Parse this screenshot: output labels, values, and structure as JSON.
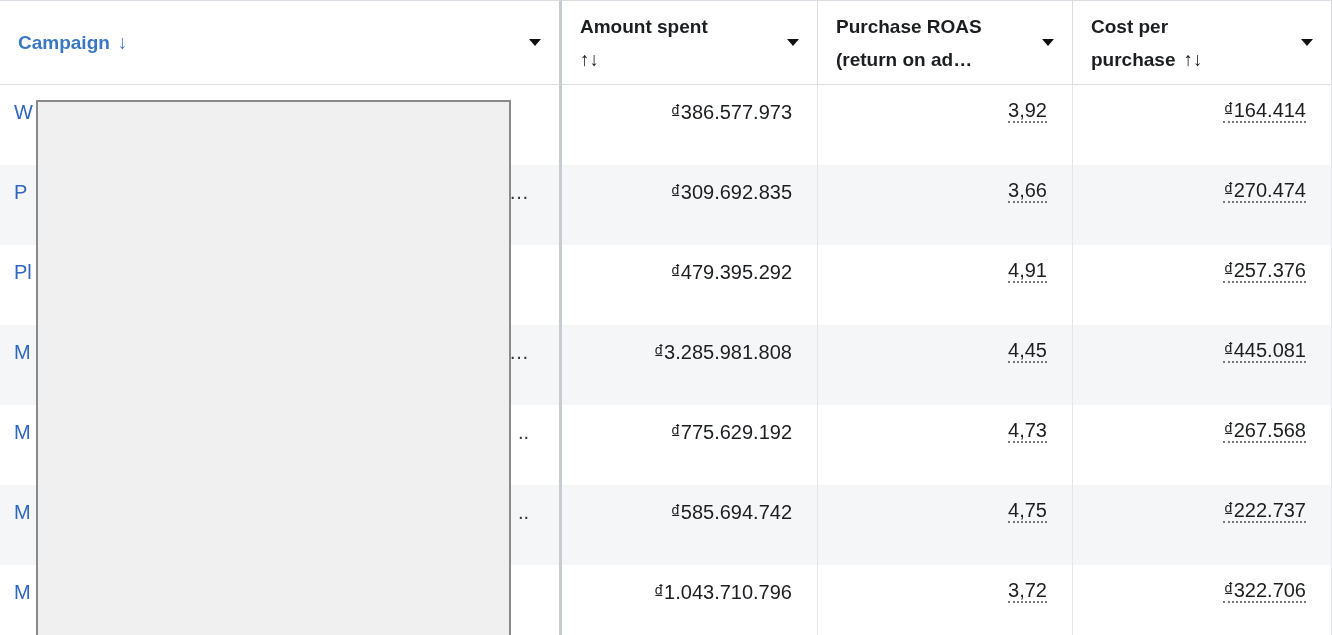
{
  "table": {
    "columns": [
      {
        "label": "Campaign",
        "sort_glyph": "↓",
        "sorted": true
      },
      {
        "label": "Amount spent",
        "sort_glyph": "↑↓",
        "sorted": false
      },
      {
        "label": "Purchase ROAS (return on ad…",
        "sorted": false
      },
      {
        "label": "Cost per purchase",
        "sort_glyph": "↑↓",
        "sorted": false
      }
    ],
    "rows": [
      {
        "campaign_start": "W",
        "amount_spent": "₫386.577.973",
        "purchase_roas": "3,92",
        "cost_per_purchase": "₫164.414"
      },
      {
        "campaign_start": "P",
        "campaign_end": "…",
        "amount_spent": "₫309.692.835",
        "purchase_roas": "3,66",
        "cost_per_purchase": "₫270.474"
      },
      {
        "campaign_start": "Pl",
        "amount_spent": "₫479.395.292",
        "purchase_roas": "4,91",
        "cost_per_purchase": "₫257.376"
      },
      {
        "campaign_start": "M",
        "campaign_end": "…",
        "amount_spent": "₫3.285.981.808",
        "purchase_roas": "4,45",
        "cost_per_purchase": "₫445.081"
      },
      {
        "campaign_start": "M",
        "campaign_end": "..",
        "amount_spent": "₫775.629.192",
        "purchase_roas": "4,73",
        "cost_per_purchase": "₫267.568"
      },
      {
        "campaign_start": "M",
        "campaign_end": "..",
        "amount_spent": "₫585.694.742",
        "purchase_roas": "4,75",
        "cost_per_purchase": "₫222.737"
      },
      {
        "campaign_start": "M",
        "amount_spent": "₫1.043.710.796",
        "purchase_roas": "3,72",
        "cost_per_purchase": "₫322.706"
      }
    ]
  }
}
